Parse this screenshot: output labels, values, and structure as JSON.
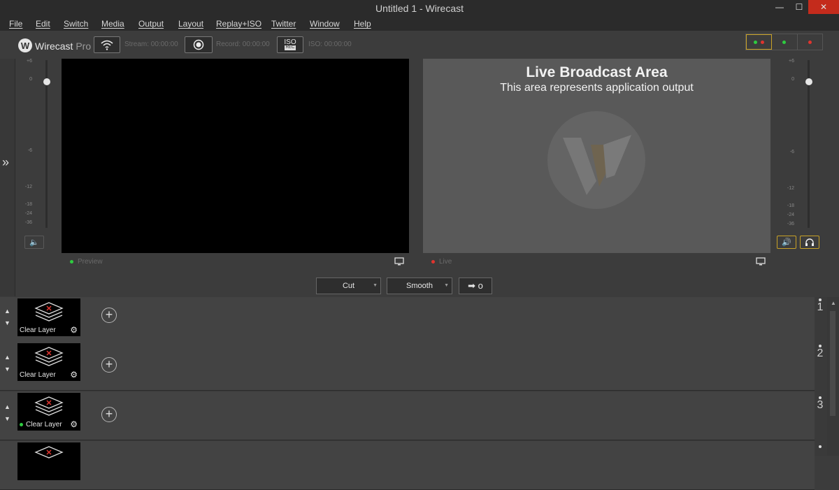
{
  "window": {
    "title": "Untitled 1 - Wirecast",
    "minimize": "—",
    "maximize": "☐",
    "close": "✕"
  },
  "menu": [
    "File",
    "Edit",
    "Switch",
    "Media",
    "Output",
    "Layout",
    "Replay+ISO",
    "Twitter",
    "Window",
    "Help"
  ],
  "toolbar": {
    "brand": "Wirecast",
    "edition": "Pro",
    "stream_label": "Stream: 00:00:00",
    "record_label": "Record: 00:00:00",
    "iso_button": "ISO",
    "iso_sub": "REC",
    "iso_label": "ISO: 00:00:00"
  },
  "meter_scale": [
    "+6",
    "0",
    "-6",
    "-12",
    "-18",
    "-24",
    "-36"
  ],
  "preview": {
    "label": "Preview"
  },
  "live": {
    "label": "Live",
    "heading": "Live Broadcast Area",
    "subheading": "This area represents application output"
  },
  "transitions": {
    "first": "Cut",
    "second": "Smooth",
    "go_icon": "➡ o"
  },
  "layers": [
    {
      "label": "Clear Layer",
      "number": "1",
      "live": false
    },
    {
      "label": "Clear Layer",
      "number": "2",
      "live": false
    },
    {
      "label": "Clear Layer",
      "number": "3",
      "live": true
    }
  ],
  "colors": {
    "accent": "#c9a227",
    "live": "#e0342e",
    "preview": "#2ecc40"
  }
}
